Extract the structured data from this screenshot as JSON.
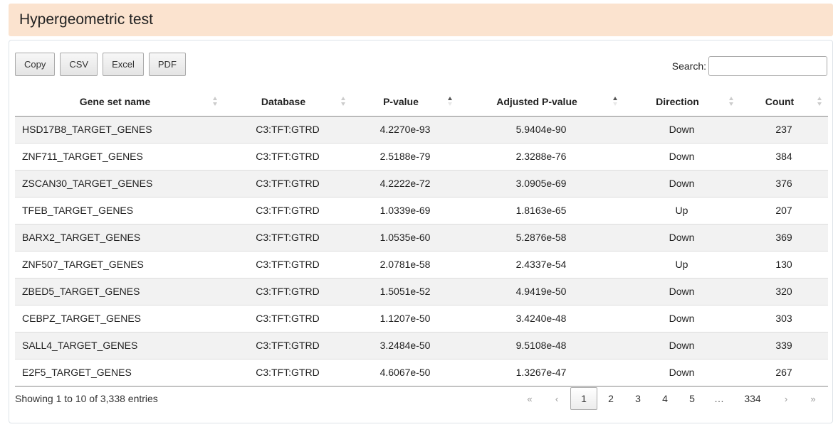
{
  "page": {
    "title": "Hypergeometric test"
  },
  "toolbar": {
    "buttons": [
      "Copy",
      "CSV",
      "Excel",
      "PDF"
    ]
  },
  "search": {
    "label": "Search:",
    "value": "",
    "placeholder": ""
  },
  "table": {
    "columns": [
      {
        "label": "Gene set name",
        "sort": "none"
      },
      {
        "label": "Database",
        "sort": "none"
      },
      {
        "label": "P-value",
        "sort": "asc"
      },
      {
        "label": "Adjusted P-value",
        "sort": "asc"
      },
      {
        "label": "Direction",
        "sort": "none"
      },
      {
        "label": "Count",
        "sort": "none"
      }
    ],
    "rows": [
      [
        "HSD17B8_TARGET_GENES",
        "C3:TFT:GTRD",
        "4.2270e-93",
        "5.9404e-90",
        "Down",
        "237"
      ],
      [
        "ZNF711_TARGET_GENES",
        "C3:TFT:GTRD",
        "2.5188e-79",
        "2.3288e-76",
        "Down",
        "384"
      ],
      [
        "ZSCAN30_TARGET_GENES",
        "C3:TFT:GTRD",
        "4.2222e-72",
        "3.0905e-69",
        "Down",
        "376"
      ],
      [
        "TFEB_TARGET_GENES",
        "C3:TFT:GTRD",
        "1.0339e-69",
        "1.8163e-65",
        "Up",
        "207"
      ],
      [
        "BARX2_TARGET_GENES",
        "C3:TFT:GTRD",
        "1.0535e-60",
        "5.2876e-58",
        "Down",
        "369"
      ],
      [
        "ZNF507_TARGET_GENES",
        "C3:TFT:GTRD",
        "2.0781e-58",
        "2.4337e-54",
        "Up",
        "130"
      ],
      [
        "ZBED5_TARGET_GENES",
        "C3:TFT:GTRD",
        "1.5051e-52",
        "4.9419e-50",
        "Down",
        "320"
      ],
      [
        "CEBPZ_TARGET_GENES",
        "C3:TFT:GTRD",
        "1.1207e-50",
        "3.4240e-48",
        "Down",
        "303"
      ],
      [
        "SALL4_TARGET_GENES",
        "C3:TFT:GTRD",
        "3.2484e-50",
        "9.5108e-48",
        "Down",
        "339"
      ],
      [
        "E2F5_TARGET_GENES",
        "C3:TFT:GTRD",
        "4.6067e-50",
        "1.3267e-47",
        "Down",
        "267"
      ]
    ]
  },
  "footer": {
    "info": "Showing 1 to 10 of 3,338 entries",
    "pagination": {
      "first": "«",
      "prev": "‹",
      "pages": [
        "1",
        "2",
        "3",
        "4",
        "5"
      ],
      "current": "1",
      "ellipsis": "…",
      "last_page": "334",
      "next": "›",
      "last": "»"
    }
  },
  "colors": {
    "header_bg": "#fbe3cf",
    "stripe": "#f2f2f2"
  }
}
